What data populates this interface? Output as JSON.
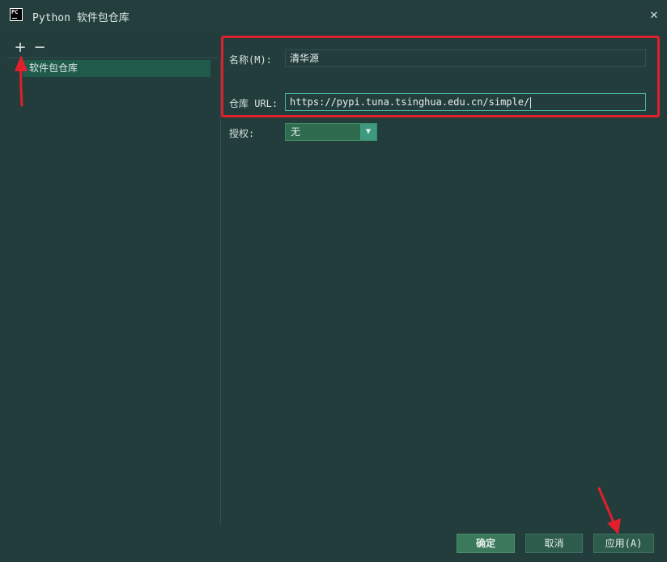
{
  "window": {
    "title": "Python 软件包仓库",
    "app_icon_text": "PC"
  },
  "left_pane": {
    "add_symbol": "+",
    "remove_symbol": "−",
    "items": [
      {
        "label": "软件包仓库"
      }
    ]
  },
  "form": {
    "name_label": "名称(M):",
    "name_value": "清华源",
    "url_label": "仓库 URL:",
    "url_value": "https://pypi.tuna.tsinghua.edu.cn/simple/",
    "auth_label": "授权:",
    "auth_value": "无"
  },
  "buttons": {
    "ok": "确定",
    "cancel": "取消",
    "apply": "应用(A)"
  },
  "colors": {
    "background": "#223d3c",
    "highlight_box": "#e0202b",
    "selection": "#1f5a4b",
    "annotation_arrow": "#e0202b"
  }
}
